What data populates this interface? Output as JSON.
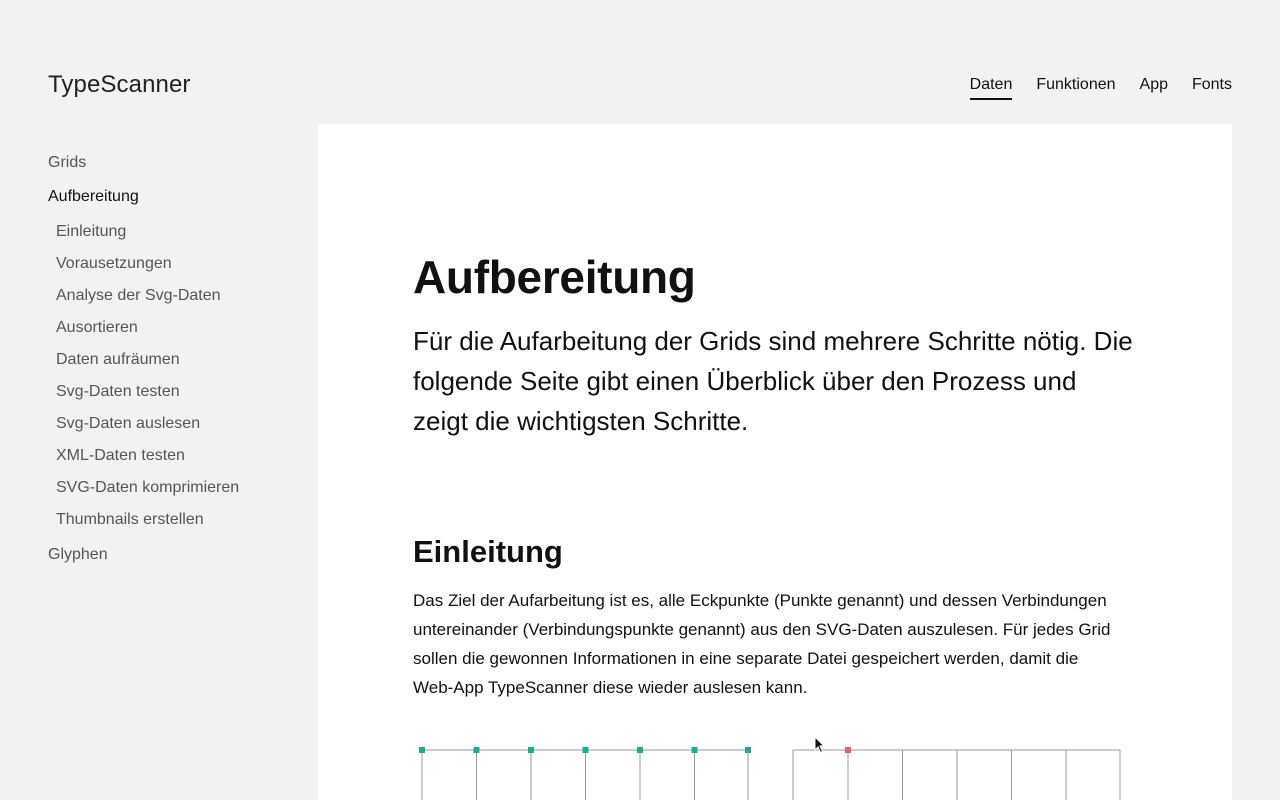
{
  "header": {
    "logo": "TypeScanner",
    "nav": [
      {
        "label": "Daten",
        "active": true
      },
      {
        "label": "Funktionen"
      },
      {
        "label": "App"
      },
      {
        "label": "Fonts"
      }
    ]
  },
  "sidebar": {
    "top_items": [
      "Grids",
      "Aufbereitung",
      "Glyphen"
    ],
    "active": "Aufbereitung",
    "sub_items": [
      "Einleitung",
      "Vorausetzungen",
      "Analyse der Svg-Daten",
      "Ausortieren",
      "Daten aufräumen",
      "Svg-Daten testen",
      "Svg-Daten auslesen",
      "XML-Daten testen",
      "SVG-Daten komprimieren",
      "Thumbnails erstellen"
    ]
  },
  "main": {
    "title": "Aufbereitung",
    "lead": "Für die Aufarbeitung der Grids sind mehrere Schritte nötig. Die folgende Seite gibt einen Überblick über den Prozess und zeigt die wichtigsten Schritte.",
    "section_title": "Einleitung",
    "section_text": "Das Ziel der Aufarbeitung ist es, alle Eckpunkte (Punkte genannt) und dessen Verbindungen untereinander (Verbindungspunkte genannt) aus den SVG-Daten auszulesen. Für jedes Grid sollen die gewonnen Informationen in eine separate Datei gespeichert werden, damit die Web-App TypeScanner diese wieder auslesen kann."
  },
  "colors": {
    "point_green": "#1aaf8b",
    "point_red": "#f05a5a",
    "grid_line": "#999999"
  },
  "illustration": {
    "left_points": 7,
    "right_columns": 7,
    "right_highlighted_point": 2
  }
}
